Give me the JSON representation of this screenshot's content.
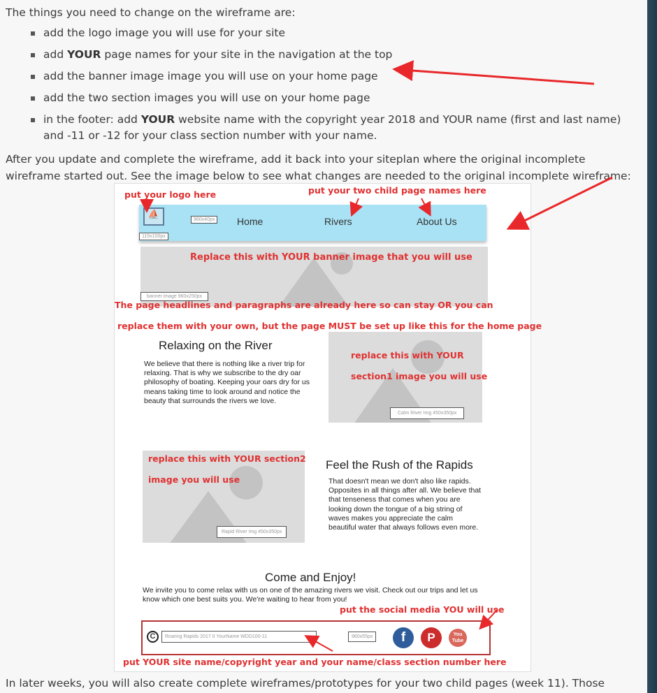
{
  "intro": "The things you need to change on the wireframe are:",
  "changes": [
    {
      "pre": "add the logo image you will use for your site",
      "bold": "",
      "post": ""
    },
    {
      "pre": "add ",
      "bold": "YOUR",
      "post": " page names for your site in the navigation at the top"
    },
    {
      "pre": "add the banner image image you will use on your home page",
      "bold": "",
      "post": ""
    },
    {
      "pre": "add the two section images you will use on your home page",
      "bold": "",
      "post": ""
    },
    {
      "pre": "in the footer:  add ",
      "bold": "YOUR",
      "post": " website name with the copyright year 2018 and YOUR name (first and last name) and -11 or -12 for your class section number with your name."
    }
  ],
  "after_text": "After you update and complete the wireframe, add it back into your siteplan where the original incomplete wireframe started out.  See the image below to see what changes are needed to the original incomplete wireframe:",
  "wireframe": {
    "notes": {
      "logo": "put your logo here",
      "child_pages": "put your two child page names here",
      "banner": "Replace this with YOUR banner image that you will use",
      "headlines1": "The page headlines and paragraphs are already here so can stay OR you can",
      "headlines2": "replace them with your own, but the page MUST be set up like this for the home page",
      "section1a": "replace this with YOUR",
      "section1b": "section1 image you will use",
      "section2a": "replace this with YOUR section2",
      "section2b": "image you will use",
      "social": "put the social media YOU will use",
      "footer": "put YOUR site name/copyright year and your name/class section number here"
    },
    "nav": {
      "links": [
        "Home",
        "Rivers",
        "About Us"
      ],
      "logo_size": "115x100px",
      "nav_size": "960x40px"
    },
    "banner_size": "banner image  960x250px",
    "section1": {
      "title": "Relaxing on the River",
      "body": "We believe that there is nothing like a river trip for relaxing. That is why we subscribe to the dry oar philosophy of boating. Keeping your oars dry for us means taking time to look around and notice the beauty that surrounds the rivers we love.",
      "img_label": "Calm River Img   450x350px"
    },
    "section2": {
      "title": "Feel the Rush of the Rapids",
      "body": "That doesn't mean we don't also like rapids. Opposites in all things after all. We believe that that tenseness that comes when you are looking down the tongue of a big string of waves makes you appreciate the calm beautiful water that always follows even more.",
      "img_label": "Rapid River Img   450x350px"
    },
    "come": {
      "title": "Come and Enjoy!",
      "body": "We invite you to come relax with us on one of the amazing rivers we visit. Check out our trips and let us know which one best suits you. We're waiting to hear from you!"
    },
    "footer": {
      "copyright_symbol": "C",
      "site_text": "Roaring Rapids 2017  II YourName  WDD100-11",
      "size": "960x55px",
      "social": [
        "f",
        "P",
        "You Tube"
      ]
    }
  },
  "bottom": "In later weeks, you will also create complete wireframes/prototypes for your two child pages (week 11).  Those"
}
